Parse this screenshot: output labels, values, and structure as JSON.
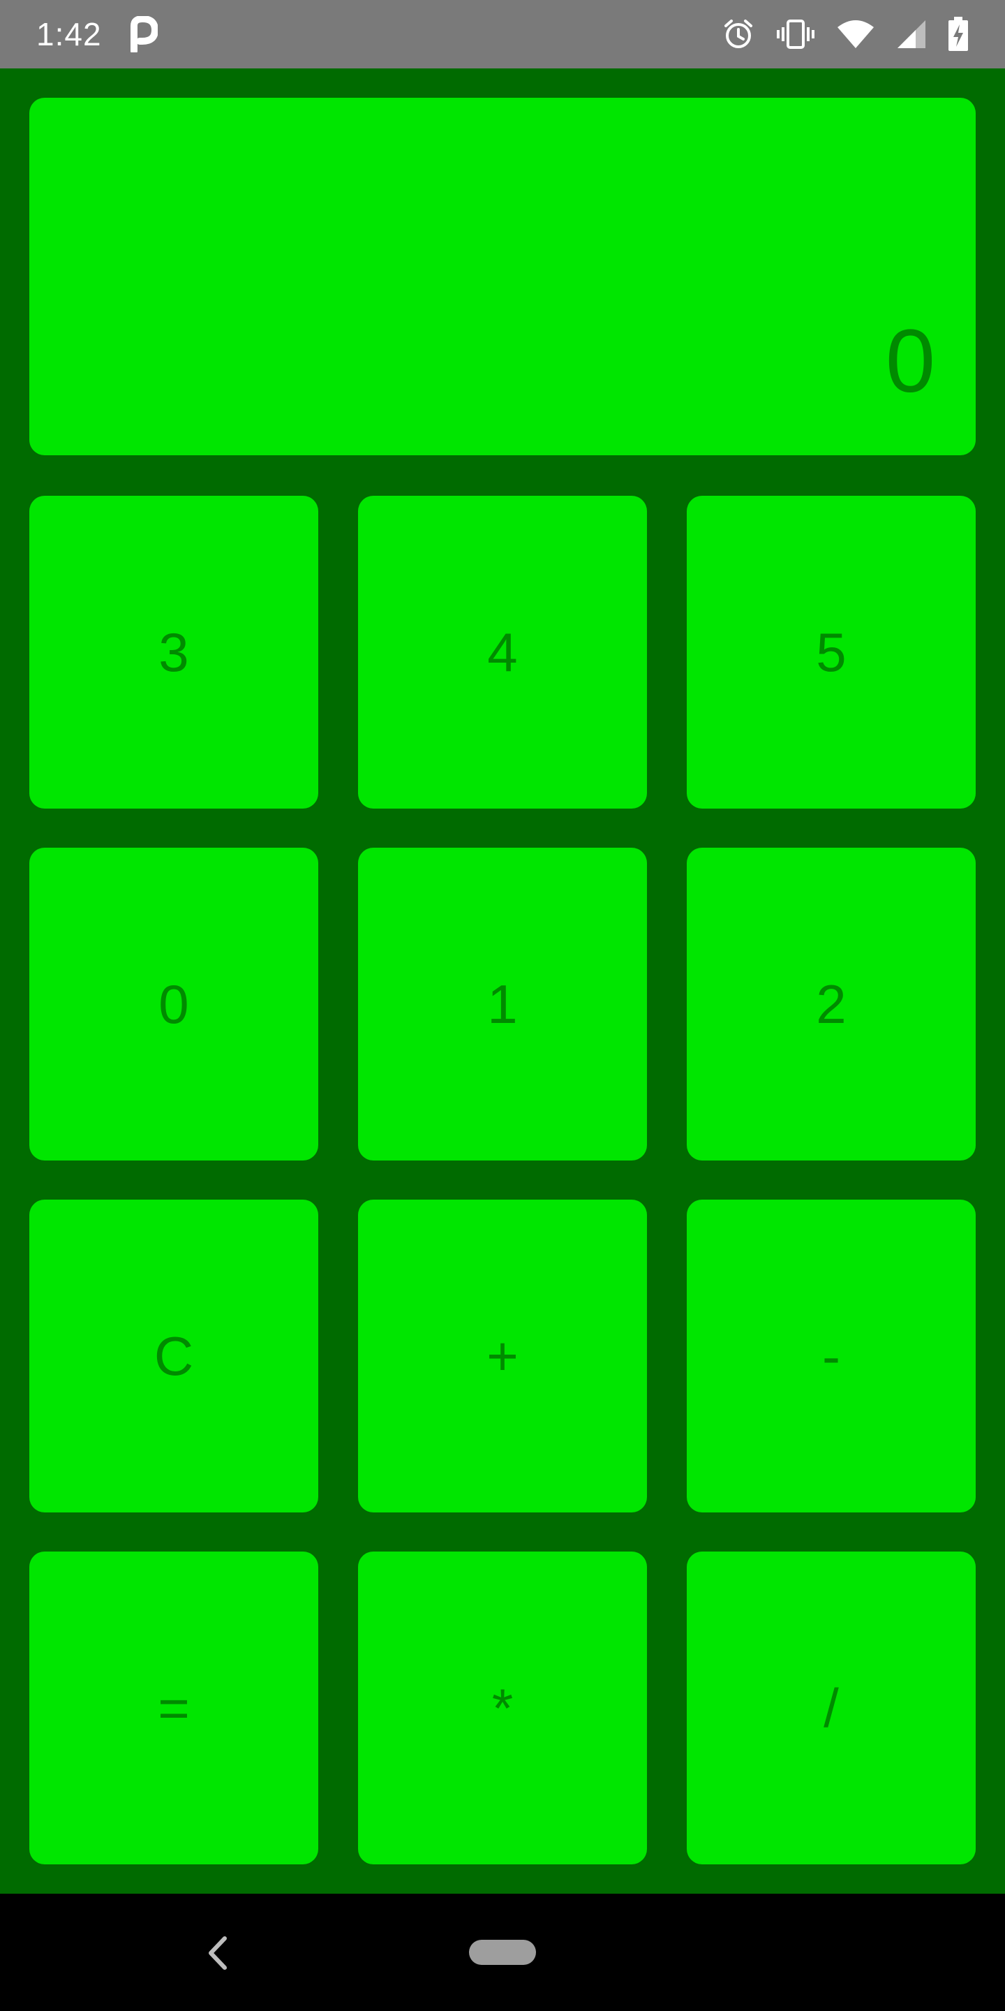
{
  "status_bar": {
    "time": "1:42",
    "icons": [
      "p-app-icon",
      "alarm-icon",
      "vibrate-icon",
      "wifi-icon",
      "signal-icon",
      "battery-charging-icon"
    ]
  },
  "display": {
    "value": "0"
  },
  "keys": [
    "3",
    "4",
    "5",
    "0",
    "1",
    "2",
    "C",
    "+",
    "-",
    "=",
    "*",
    "/"
  ],
  "nav_bar": {
    "icons": [
      "back-icon",
      "home-pill"
    ]
  },
  "colors": {
    "background": "#006b00",
    "key_fill": "#00e600",
    "key_text": "#008a00",
    "status_bar": "#7a7a7a",
    "nav_bar": "#000000"
  }
}
